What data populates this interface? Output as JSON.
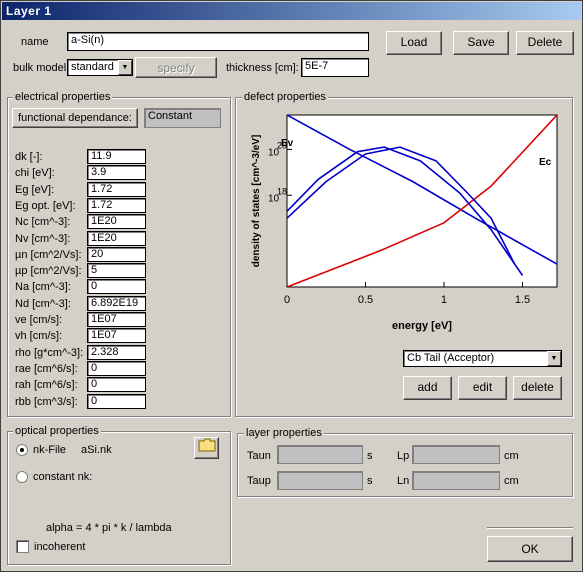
{
  "window": {
    "title": "Layer 1"
  },
  "header": {
    "name_label": "name",
    "name_value": "a-Si(n)",
    "bulk_model_label": "bulk model",
    "bulk_model_value": "standard",
    "specify_label": "specify",
    "thickness_label": "thickness [cm]:",
    "thickness_value": "5E-7",
    "load_label": "Load",
    "save_label": "Save",
    "delete_label": "Delete"
  },
  "electrical": {
    "title": "electrical properties",
    "functional_label": "functional dependance:",
    "functional_value": "Constant",
    "rows": [
      {
        "label": "dk [-]:",
        "value": "11.9"
      },
      {
        "label": "chi [eV]:",
        "value": "3.9"
      },
      {
        "label": "Eg [eV]:",
        "value": "1.72"
      },
      {
        "label": "Eg opt. [eV]:",
        "value": "1.72"
      },
      {
        "label": "Nc [cm^-3]:",
        "value": "1E20"
      },
      {
        "label": "Nv [cm^-3]:",
        "value": "1E20"
      },
      {
        "label": "µn [cm^2/Vs]:",
        "value": "20"
      },
      {
        "label": "µp [cm^2/Vs]:",
        "value": "5"
      },
      {
        "label": "Na [cm^-3]:",
        "value": "0"
      },
      {
        "label": "Nd [cm^-3]:",
        "value": "6.892E19"
      },
      {
        "label": "ve [cm/s]:",
        "value": "1E07"
      },
      {
        "label": "vh [cm/s]:",
        "value": "1E07"
      },
      {
        "label": "rho [g*cm^-3]:",
        "value": "2.328"
      },
      {
        "label": "rae [cm^6/s]:",
        "value": "0"
      },
      {
        "label": "rah [cm^6/s]:",
        "value": "0"
      },
      {
        "label": "rbb [cm^3/s]:",
        "value": "0"
      }
    ]
  },
  "defect": {
    "title": "defect properties",
    "dropdown_value": "Cb Tail (Acceptor)",
    "add_label": "add",
    "edit_label": "edit",
    "delete_label": "delete"
  },
  "chart_data": {
    "type": "line",
    "xlabel": "energy [eV]",
    "ylabel": "density of states [cm^-3/eV]",
    "xlim": [
      0,
      1.72
    ],
    "x_ticks": [
      "0",
      "0.5",
      "1",
      "1.5"
    ],
    "y_ticks": [
      {
        "base": "10",
        "exp": "20"
      },
      {
        "base": "10",
        "exp": "18"
      }
    ],
    "annotations": [
      "Ev",
      "Ec"
    ],
    "colors": {
      "blue": "#0000cc",
      "red": "#dd0000"
    },
    "series": [
      {
        "color": "blue",
        "x": [
          0,
          0.4,
          0.8,
          1.2,
          1.72
        ],
        "y": [
          21.5,
          20.0,
          18.6,
          17.0,
          15.0
        ]
      },
      {
        "color": "red",
        "x": [
          0,
          0.6,
          1.0,
          1.3,
          1.72
        ],
        "y": [
          14.0,
          15.6,
          16.8,
          18.4,
          21.5
        ]
      },
      {
        "color": "blue",
        "x": [
          0,
          0.2,
          0.45,
          0.62,
          0.85,
          1.1,
          1.3,
          1.5
        ],
        "y": [
          17.3,
          18.7,
          19.9,
          20.1,
          19.5,
          18.1,
          16.5,
          14.5
        ]
      },
      {
        "color": "blue",
        "x": [
          0,
          0.25,
          0.5,
          0.72,
          0.95,
          1.15,
          1.3,
          1.45
        ],
        "y": [
          17.0,
          18.6,
          19.8,
          20.1,
          19.5,
          18.1,
          17.0,
          15.0
        ]
      }
    ]
  },
  "optical": {
    "title": "optical properties",
    "nk_file_label": "nk-File",
    "nk_file_value": "aSi.nk",
    "constant_nk_label": "constant nk:",
    "alpha_formula": "alpha = 4 * pi * k / lambda",
    "incoherent_label": "incoherent"
  },
  "layer": {
    "title": "layer properties",
    "taun_label": "Taun",
    "taup_label": "Taup",
    "lp_label": "Lp",
    "ln_label": "Ln",
    "unit_s": "s",
    "unit_cm": "cm"
  },
  "footer": {
    "ok_label": "OK"
  }
}
